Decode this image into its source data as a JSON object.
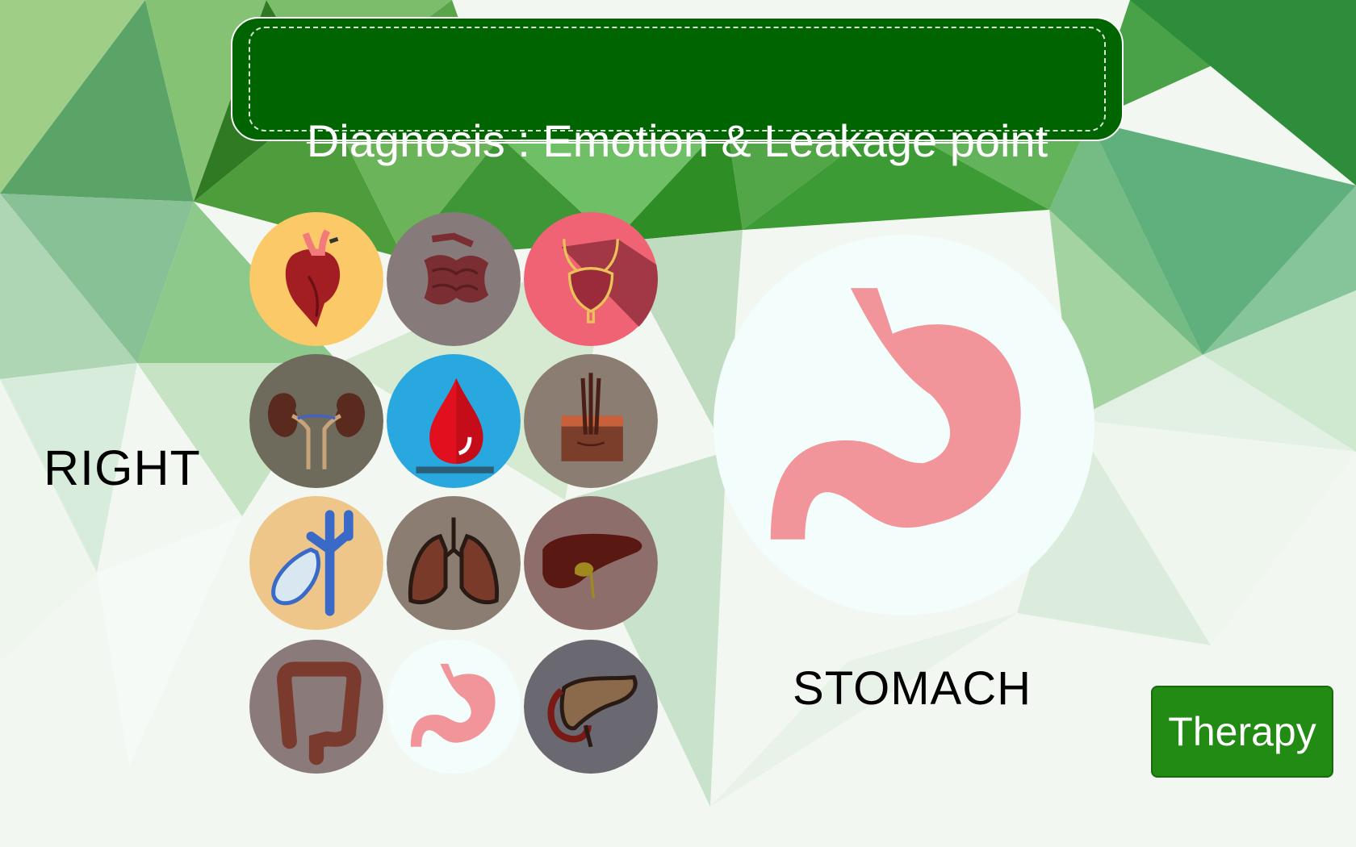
{
  "header": {
    "title": "Diagnosis : Emotion & Leakage point"
  },
  "side_label": "RIGHT",
  "organs": [
    {
      "icon": "heart-icon",
      "bg": "#fbc967"
    },
    {
      "icon": "small-intestine-icon",
      "bg": "#877a7a"
    },
    {
      "icon": "bladder-icon",
      "bg": "#ef6374"
    },
    {
      "icon": "kidneys-icon",
      "bg": "#6e6a5c"
    },
    {
      "icon": "blood-drop-icon",
      "bg": "#29a8e0"
    },
    {
      "icon": "skin-hair-icon",
      "bg": "#8b7d71"
    },
    {
      "icon": "gallbladder-icon",
      "bg": "#eec68a"
    },
    {
      "icon": "lungs-icon",
      "bg": "#8b7d71"
    },
    {
      "icon": "liver-icon",
      "bg": "#8e6e6a"
    },
    {
      "icon": "large-intestine-icon",
      "bg": "#8a7a7a"
    },
    {
      "icon": "stomach-icon",
      "bg": "#f3fdfb"
    },
    {
      "icon": "pancreas-icon",
      "bg": "#6a6870"
    }
  ],
  "selected": {
    "name": "STOMACH",
    "icon": "stomach-icon"
  },
  "therapy_button": {
    "label": "Therapy"
  },
  "colors": {
    "banner": "#006400",
    "button": "#228b14",
    "stomach_pink": "#f2959a"
  }
}
